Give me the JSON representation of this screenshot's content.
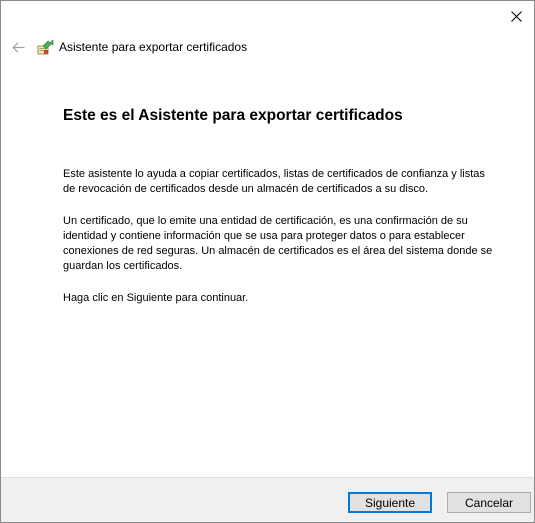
{
  "window": {
    "close_label": "Close"
  },
  "header": {
    "title": "Asistente para exportar certificados"
  },
  "content": {
    "heading": "Este es el Asistente para exportar certificados",
    "paragraph1": "Este asistente lo ayuda a copiar certificados, listas de certificados de confianza y listas de revocación de certificados desde un almacén de certificados a su disco.",
    "paragraph2": "Un certificado, que lo emite una entidad de certificación, es una confirmación de su identidad y contiene información que se usa para proteger datos o para establecer conexiones de red seguras. Un almacén de certificados es el área del sistema donde se guardan los certificados.",
    "paragraph3": "Haga clic en Siguiente para continuar."
  },
  "footer": {
    "next_label": "Siguiente",
    "cancel_label": "Cancelar"
  },
  "colors": {
    "accent": "#0078d7",
    "footer_bg": "#f0f0f0"
  },
  "icons": {
    "close": "close-icon",
    "back": "back-arrow-icon",
    "wizard": "certificate-wizard-icon"
  }
}
